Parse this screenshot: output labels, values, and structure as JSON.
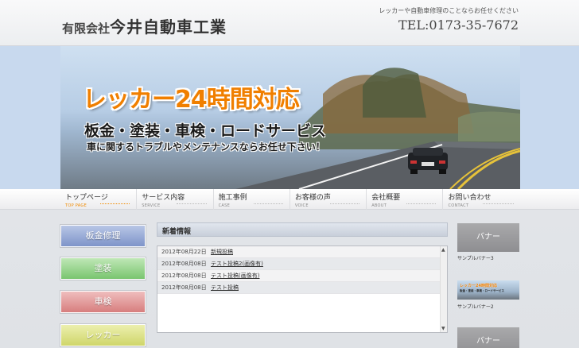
{
  "header": {
    "company_prefix": "有限会社",
    "company_name": "今井自動車工業",
    "tagline": "レッカーや自動車修理のことならお任せください",
    "tel": "TEL:0173-35-7672"
  },
  "hero": {
    "headline": "レッカー24時間対応",
    "services": "板金・塗装・車検・ロードサービス",
    "subline": "車に関するトラブルやメンテナンスならお任せ下さい！"
  },
  "nav": {
    "items": [
      {
        "label": "トップページ",
        "sub": "TOP PAGE"
      },
      {
        "label": "サービス内容",
        "sub": "SERVICE"
      },
      {
        "label": "施工事例",
        "sub": "CASE"
      },
      {
        "label": "お客様の声",
        "sub": "VOICE"
      },
      {
        "label": "会社概要",
        "sub": "ABOUT"
      },
      {
        "label": "お問い合わせ",
        "sub": "CONTACT"
      }
    ]
  },
  "sidebar": {
    "buttons": [
      "板金修理",
      "塗装",
      "車検",
      "レッカー"
    ]
  },
  "news": {
    "heading": "新着情報",
    "rows": [
      {
        "date": "2012年08月22日",
        "title": "新規投稿"
      },
      {
        "date": "2012年08月08日",
        "title": "テスト投稿2(画像有)"
      },
      {
        "date": "2012年08月08日",
        "title": "テスト投稿(画像有)"
      },
      {
        "date": "2012年08月08日",
        "title": "テスト投稿"
      }
    ]
  },
  "banners": {
    "banner1": "バナー",
    "caption1": "サンプルバナー3",
    "mini_title": "レッカー24時間対応",
    "mini_sub": "板金・塗装・車検・ロードサービス",
    "caption2": "サンプルバナー2",
    "banner3": "バナー"
  },
  "colors": {
    "accent_orange": "#f07f00",
    "hero_sky": "#c8d9ee"
  }
}
